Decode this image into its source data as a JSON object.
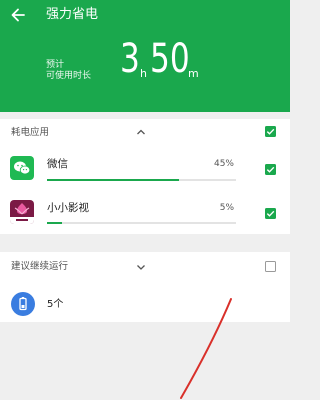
{
  "header": {
    "title": "强力省电",
    "estimate_line1": "预计",
    "estimate_line2": "可使用时长",
    "hours": "3",
    "hours_unit": "h",
    "minutes": "50",
    "minutes_unit": "m"
  },
  "power_apps": {
    "label": "耗电应用",
    "checked": true,
    "items": [
      {
        "name": "微信",
        "percent": "45%",
        "fill": 0.45,
        "checked": true
      },
      {
        "name": "小小影视",
        "percent": "5%",
        "fill": 0.05,
        "checked": true
      }
    ]
  },
  "suggest_running": {
    "label": "建议继续运行",
    "checked": false,
    "count": "5个"
  },
  "colors": {
    "accent": "#1aa84d",
    "battery_icon": "#3a7de0",
    "annotation": "#d9302a"
  }
}
